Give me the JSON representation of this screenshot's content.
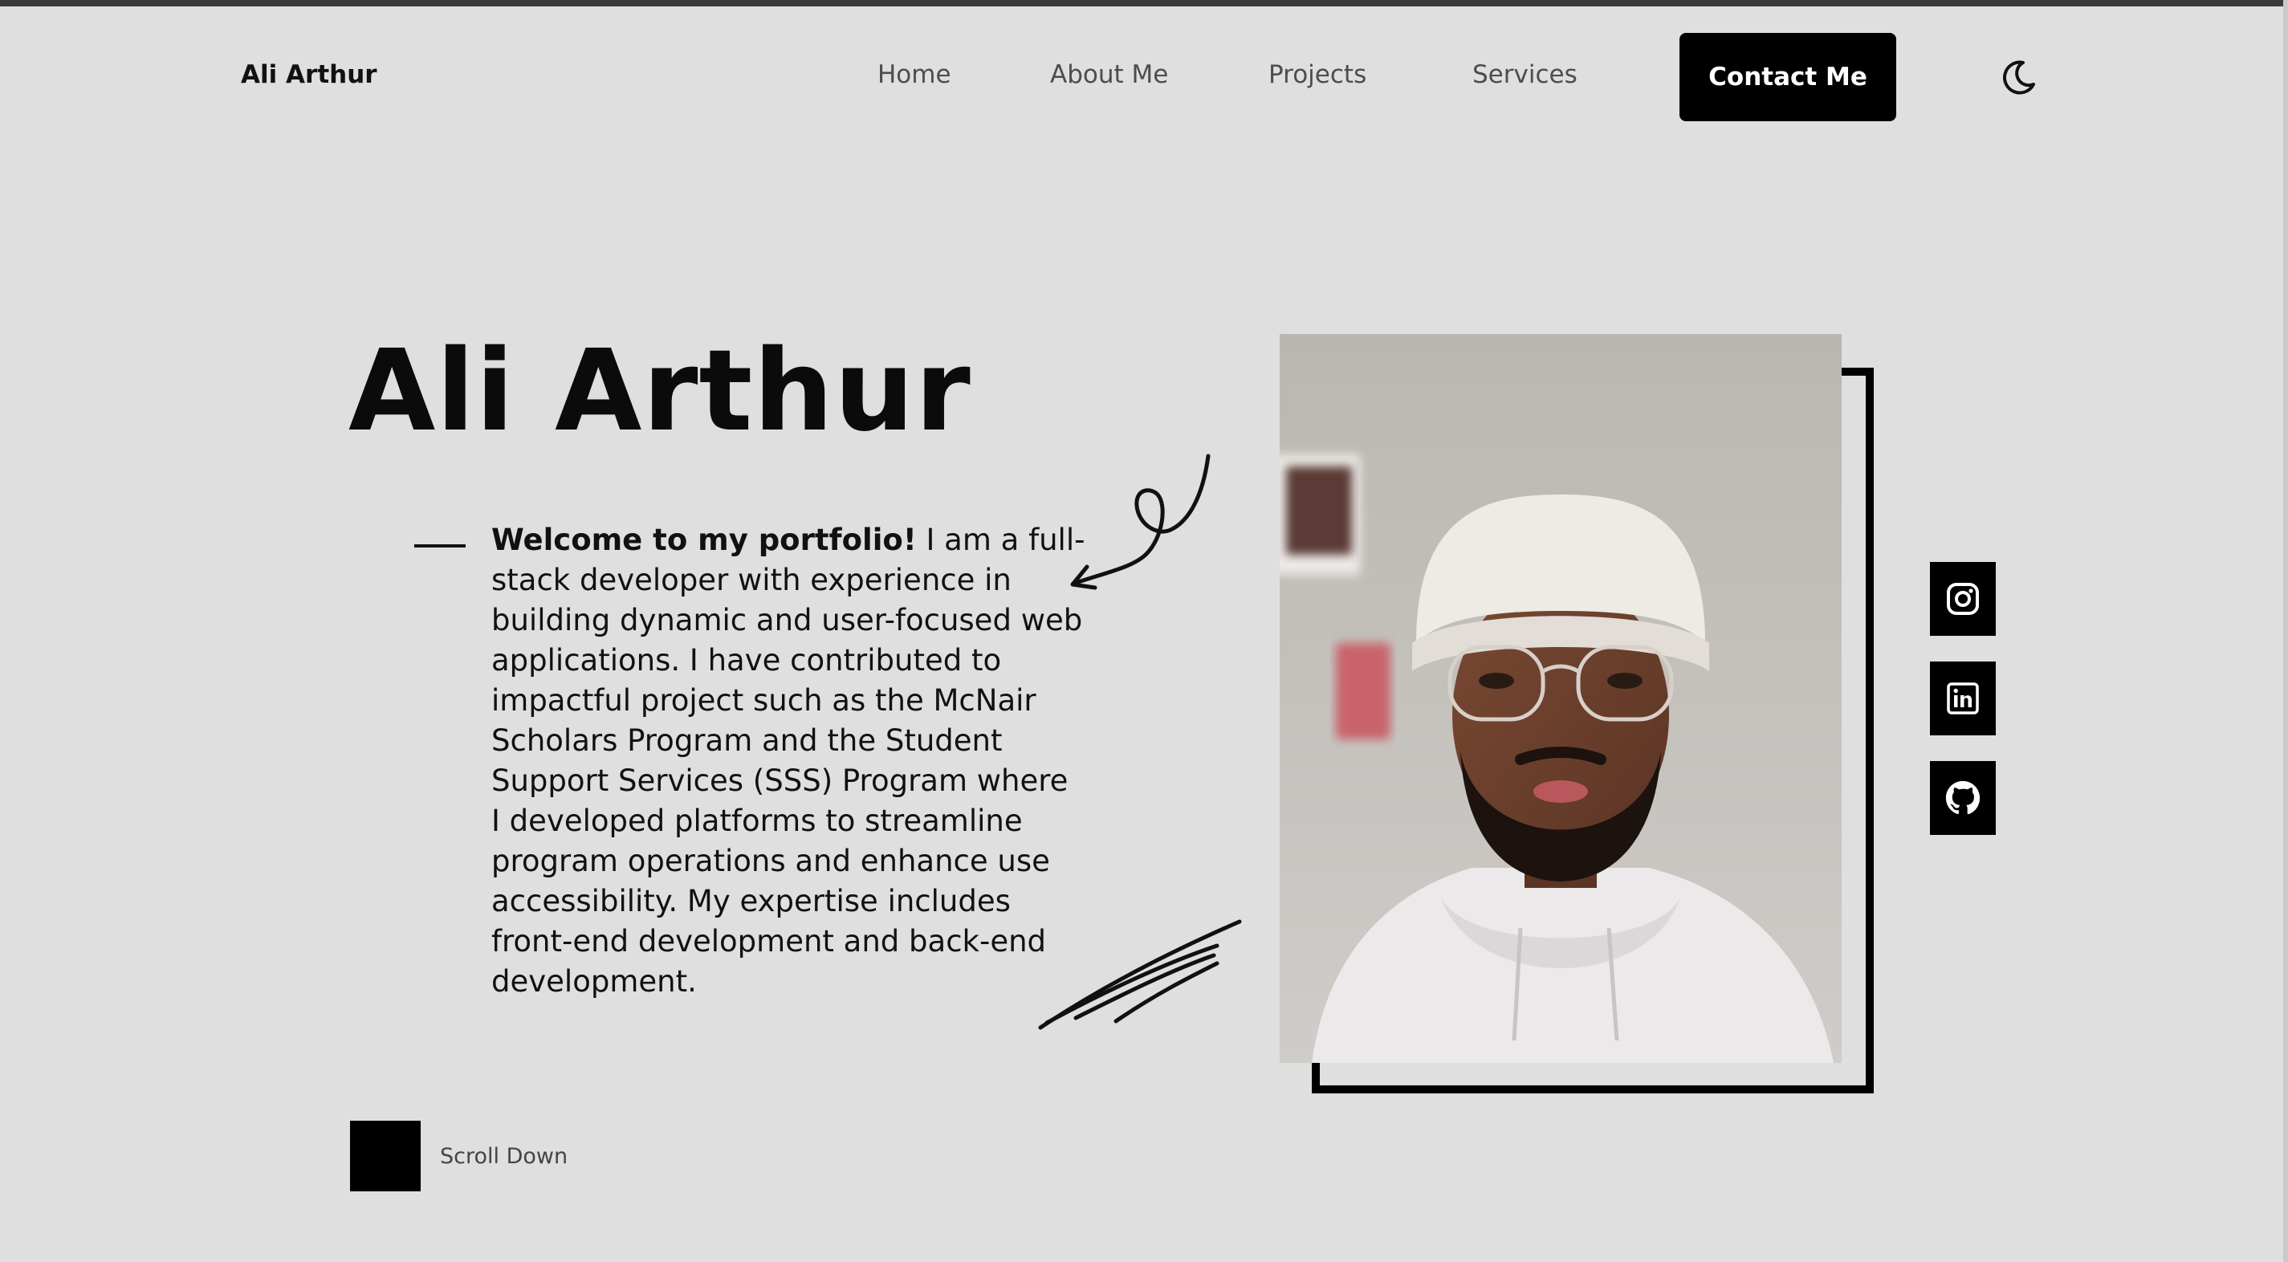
{
  "header": {
    "brand": "Ali Arthur",
    "nav": [
      "Home",
      "About Me",
      "Projects",
      "Services"
    ],
    "contact_label": "Contact Me",
    "theme_icon": "moon-icon"
  },
  "hero": {
    "name": "Ali Arthur",
    "intro_bold": "Welcome to my portfolio!",
    "intro_rest": " I am a full-stack developer with experience in building dynamic and user-focused web applications. I have contributed to impactful project such as the McNair Scholars Program and the Student Support Services (SSS) Program where I developed platforms to streamline program operations and enhance use accessibility. My expertise includes front-end development and back-end development."
  },
  "social": [
    "instagram-icon",
    "linkedin-icon",
    "github-icon"
  ],
  "scroll": {
    "label": "Scroll Down"
  },
  "colors": {
    "background": "#dfdfdf",
    "accent": "#000000",
    "nav_text": "#4d4d4d"
  }
}
